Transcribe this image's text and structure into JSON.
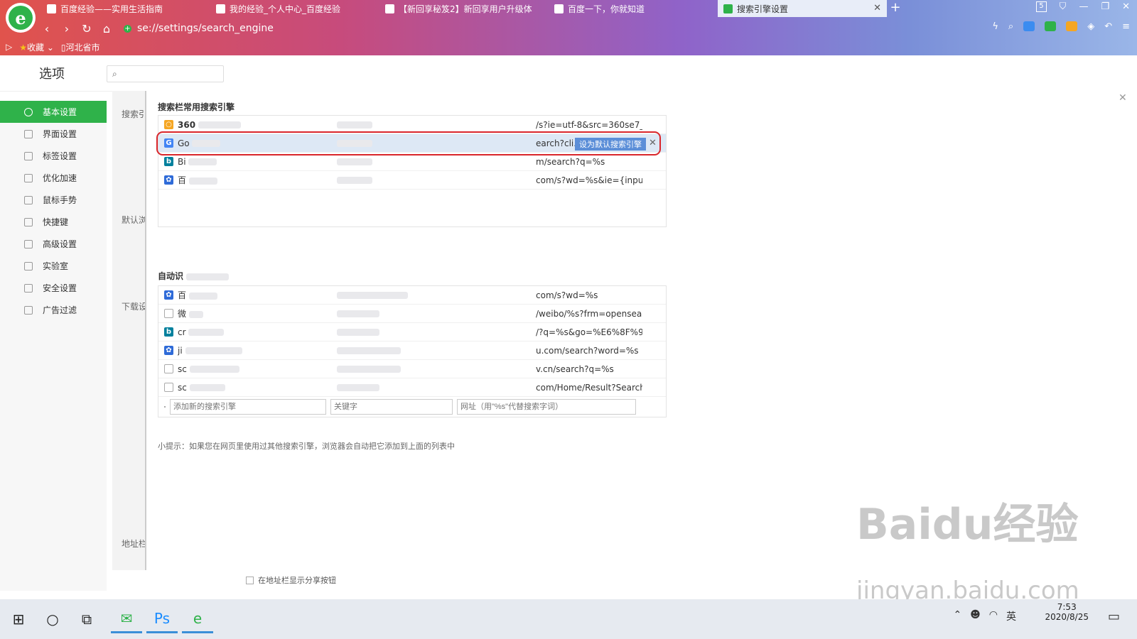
{
  "browser": {
    "tabs": [
      {
        "label": "百度经验——实用生活指南"
      },
      {
        "label": "我的经验_个人中心_百度经验"
      },
      {
        "label": "【新回享秘笈2】新回享用户升级体"
      },
      {
        "label": "百度一下，你就知道"
      },
      {
        "label": "搜索引擎设置"
      }
    ],
    "tab_count": "5",
    "address": "se://settings/search_engine",
    "bookmarks": [
      {
        "label": "收藏"
      },
      {
        "label": "河北省市"
      }
    ]
  },
  "page": {
    "title": "选项",
    "sidebar": [
      {
        "label": "基本设置",
        "active": true
      },
      {
        "label": "界面设置"
      },
      {
        "label": "标签设置"
      },
      {
        "label": "优化加速"
      },
      {
        "label": "鼠标手势"
      },
      {
        "label": "快捷键"
      },
      {
        "label": "高级设置"
      },
      {
        "label": "实验室"
      },
      {
        "label": "安全设置"
      },
      {
        "label": "广告过滤"
      }
    ],
    "section_labels": [
      "搜索引",
      "默认浏",
      "下载设",
      "地址栏"
    ],
    "share_checkbox": "在地址栏显示分享按钮"
  },
  "dialog": {
    "group1_title": "搜索栏常用搜索引擎",
    "common_engines": [
      {
        "name": "360",
        "icon": "360-icon",
        "color": "#f5a623",
        "url": "/s?ie=utf-8&src=360se7_a..."
      },
      {
        "name": "Go",
        "icon": "google-icon",
        "color": "#4285f4",
        "url": "earch?cli...",
        "highlight": true
      },
      {
        "name": "Bi",
        "icon": "bing-icon",
        "color": "#00809d",
        "url": "m/search?q=%s"
      },
      {
        "name": "百",
        "icon": "baidu-paw-icon",
        "color": "#2f6bd8",
        "url": "com/s?wd=%s&ie={inputEn..."
      }
    ],
    "set_default_label": "设为默认搜索引擎",
    "group2_title": "自动识",
    "auto_engines": [
      {
        "name": "百",
        "icon": "baidu-paw-icon",
        "color": "#2f6bd8",
        "url": "com/s?wd=%s"
      },
      {
        "name": "微",
        "icon": "page-icon",
        "color": "#aaaaaa",
        "url": "/weibo/%s?frm=opensearch"
      },
      {
        "name": "cr",
        "icon": "bing-icon",
        "color": "#00809d",
        "url": "/?q=%s&go=%E6%8F%90..."
      },
      {
        "name": "ji",
        "icon": "baidu-paw-icon",
        "color": "#2f6bd8",
        "url": "u.com/search?word=%s"
      },
      {
        "name": "sc",
        "icon": "page-icon",
        "color": "#aaaaaa",
        "url": "v.cn/search?q=%s"
      },
      {
        "name": "sc",
        "icon": "page-icon",
        "color": "#aaaaaa",
        "url": "com/Home/Result?SearchW..."
      }
    ],
    "add_engine_placeholder": "添加新的搜索引擎",
    "keyword_placeholder": "关键字",
    "url_placeholder": "网址（用\"%s\"代替搜索字词）",
    "tip": "小提示：如果您在网页里使用过其他搜索引擎，浏览器会自动把它添加到上面的列表中"
  },
  "taskbar": {
    "time": "7:53",
    "date": "2020/8/25"
  },
  "watermark": {
    "line1": "Baidu经验",
    "line2": "jingyan.baidu.com"
  }
}
